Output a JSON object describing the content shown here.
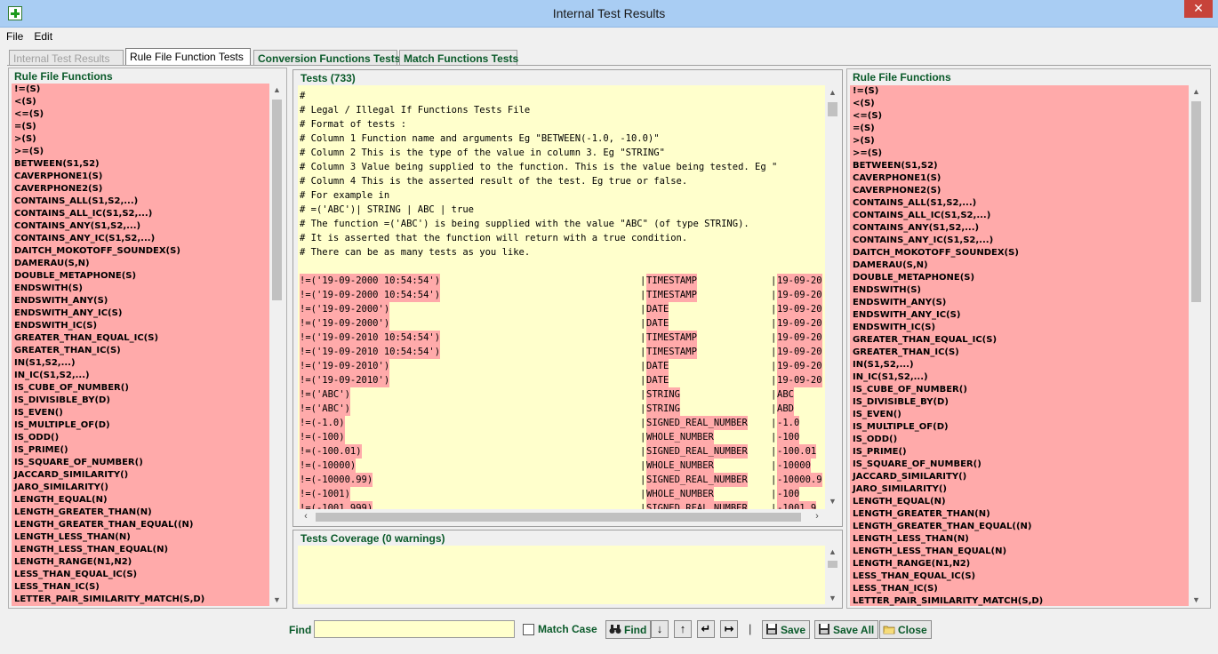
{
  "window": {
    "title": "Internal Test Results",
    "close_glyph": "✕"
  },
  "menu": {
    "items": [
      "File",
      "Edit"
    ]
  },
  "tabs": [
    {
      "label": "Internal Test Results",
      "state": "disabled"
    },
    {
      "label": "Rule File Function Tests",
      "state": "active"
    },
    {
      "label": "Conversion Functions Tests",
      "state": "normal"
    },
    {
      "label": "Match Functions Tests",
      "state": "normal"
    }
  ],
  "left_panel": {
    "title": "Rule File Functions",
    "items": [
      "!=(S)",
      "<(S)",
      "<=(S)",
      "=(S)",
      ">(S)",
      ">=(S)",
      "BETWEEN(S1,S2)",
      "CAVERPHONE1(S)",
      "CAVERPHONE2(S)",
      "CONTAINS_ALL(S1,S2,...)",
      "CONTAINS_ALL_IC(S1,S2,...)",
      "CONTAINS_ANY(S1,S2,...)",
      "CONTAINS_ANY_IC(S1,S2,...)",
      "DAITCH_MOKOTOFF_SOUNDEX(S)",
      "DAMERAU(S,N)",
      "DOUBLE_METAPHONE(S)",
      "ENDSWITH(S)",
      "ENDSWITH_ANY(S)",
      "ENDSWITH_ANY_IC(S)",
      "ENDSWITH_IC(S)",
      "GREATER_THAN_EQUAL_IC(S)",
      "GREATER_THAN_IC(S)",
      "IN(S1,S2,...)",
      "IN_IC(S1,S2,...)",
      "IS_CUBE_OF_NUMBER()",
      "IS_DIVISIBLE_BY(D)",
      "IS_EVEN()",
      "IS_MULTIPLE_OF(D)",
      "IS_ODD()",
      "IS_PRIME()",
      "IS_SQUARE_OF_NUMBER()",
      "JACCARD_SIMILARITY()",
      "JARO_SIMILARITY()",
      "LENGTH_EQUAL(N)",
      "LENGTH_GREATER_THAN(N)",
      "LENGTH_GREATER_THAN_EQUAL((N)",
      "LENGTH_LESS_THAN(N)",
      "LENGTH_LESS_THAN_EQUAL(N)",
      "LENGTH_RANGE(N1,N2)",
      "LESS_THAN_EQUAL_IC(S)",
      "LESS_THAN_IC(S)",
      "LETTER_PAIR_SIMILARITY_MATCH(S,D)"
    ]
  },
  "right_panel": {
    "title": "Rule File Functions",
    "items": [
      "!=(S)",
      "<(S)",
      "<=(S)",
      "=(S)",
      ">(S)",
      ">=(S)",
      "BETWEEN(S1,S2)",
      "CAVERPHONE1(S)",
      "CAVERPHONE2(S)",
      "CONTAINS_ALL(S1,S2,...)",
      "CONTAINS_ALL_IC(S1,S2,...)",
      "CONTAINS_ANY(S1,S2,...)",
      "CONTAINS_ANY_IC(S1,S2,...)",
      "DAITCH_MOKOTOFF_SOUNDEX(S)",
      "DAMERAU(S,N)",
      "DOUBLE_METAPHONE(S)",
      "ENDSWITH(S)",
      "ENDSWITH_ANY(S)",
      "ENDSWITH_ANY_IC(S)",
      "ENDSWITH_IC(S)",
      "GREATER_THAN_EQUAL_IC(S)",
      "GREATER_THAN_IC(S)",
      "IN(S1,S2,...)",
      "IN_IC(S1,S2,...)",
      "IS_CUBE_OF_NUMBER()",
      "IS_DIVISIBLE_BY(D)",
      "IS_EVEN()",
      "IS_MULTIPLE_OF(D)",
      "IS_ODD()",
      "IS_PRIME()",
      "IS_SQUARE_OF_NUMBER()",
      "JACCARD_SIMILARITY()",
      "JARO_SIMILARITY()",
      "LENGTH_EQUAL(N)",
      "LENGTH_GREATER_THAN(N)",
      "LENGTH_GREATER_THAN_EQUAL((N)",
      "LENGTH_LESS_THAN(N)",
      "LENGTH_LESS_THAN_EQUAL(N)",
      "LENGTH_RANGE(N1,N2)",
      "LESS_THAN_EQUAL_IC(S)",
      "LESS_THAN_IC(S)",
      "LETTER_PAIR_SIMILARITY_MATCH(S,D)"
    ]
  },
  "tests_panel": {
    "title": "Tests (733)",
    "header_lines": [
      "#",
      "# Legal / Illegal If Functions Tests File",
      "# Format of tests :",
      "# Column 1 Function name and arguments Eg \"BETWEEN(-1.0, -10.0)\"",
      "# Column 2 This is the type of the value in column 3. Eg \"STRING\"",
      "# Column 3 Value being supplied to the function. This is the value being tested. Eg \"",
      "# Column 4 This is the asserted result of the test. Eg true or false.",
      "# For example in",
      "# =('ABC')| STRING | ABC | true",
      "# The function =('ABC') is being supplied with the value \"ABC\" (of type STRING).",
      "# It is asserted that the function will return with a true condition.",
      "# There can be as many tests as you like."
    ],
    "rows": [
      {
        "fn": "!=('19-09-2000 10:54:54')",
        "type": "TIMESTAMP",
        "value": "19-09-20"
      },
      {
        "fn": "!=('19-09-2000 10:54:54')",
        "type": "TIMESTAMP",
        "value": "19-09-20"
      },
      {
        "fn": "!=('19-09-2000')",
        "type": "DATE",
        "value": "19-09-20"
      },
      {
        "fn": "!=('19-09-2000')",
        "type": "DATE",
        "value": "19-09-20"
      },
      {
        "fn": "!=('19-09-2010 10:54:54')",
        "type": "TIMESTAMP",
        "value": "19-09-20"
      },
      {
        "fn": "!=('19-09-2010 10:54:54')",
        "type": "TIMESTAMP",
        "value": "19-09-20"
      },
      {
        "fn": "!=('19-09-2010')",
        "type": "DATE",
        "value": "19-09-20"
      },
      {
        "fn": "!=('19-09-2010')",
        "type": "DATE",
        "value": "19-09-20"
      },
      {
        "fn": "!=('ABC')",
        "type": "STRING",
        "value": "ABC"
      },
      {
        "fn": "!=('ABC')",
        "type": "STRING",
        "value": "ABD"
      },
      {
        "fn": "!=(-1.0)",
        "type": "SIGNED_REAL_NUMBER",
        "value": "-1.0"
      },
      {
        "fn": "!=(-100)",
        "type": "WHOLE_NUMBER",
        "value": "-100"
      },
      {
        "fn": "!=(-100.01)",
        "type": "SIGNED_REAL_NUMBER",
        "value": "-100.01"
      },
      {
        "fn": "!=(-10000)",
        "type": "WHOLE_NUMBER",
        "value": "-10000"
      },
      {
        "fn": "!=(-10000.99)",
        "type": "SIGNED_REAL_NUMBER",
        "value": "-10000.9"
      },
      {
        "fn": "!=(-1001)",
        "type": "WHOLE_NUMBER",
        "value": "-100"
      },
      {
        "fn": "!=(-1001.999)",
        "type": "SIGNED_REAL_NUMBER",
        "value": "-1001.9"
      }
    ]
  },
  "coverage_panel": {
    "title": "Tests Coverage (0 warnings)"
  },
  "bottom": {
    "find_label": "Find",
    "find_value": "",
    "match_case_label": "Match Case",
    "find_button": "Find",
    "separator": "|",
    "save_button": "Save",
    "save_all_button": "Save All",
    "close_button": "Close",
    "nav_glyphs": {
      "next": "↓",
      "prev": "↑",
      "first": "↵",
      "last": "↦"
    }
  }
}
